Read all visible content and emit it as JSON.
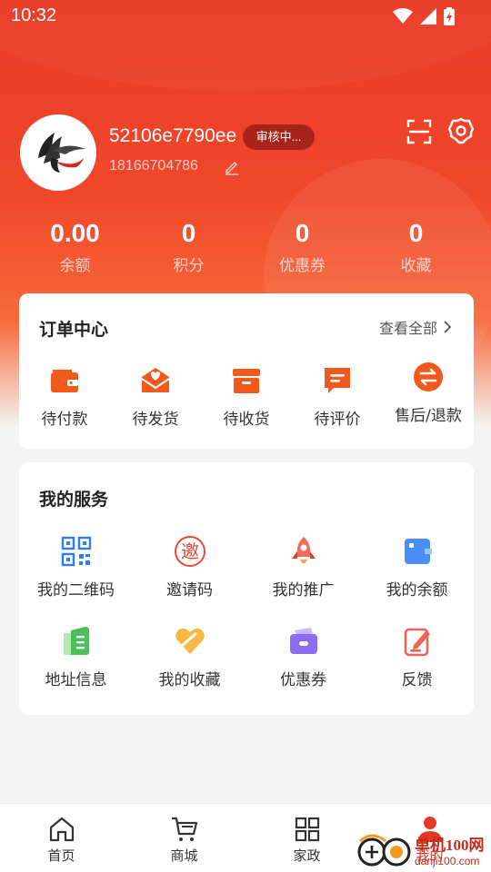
{
  "status_bar": {
    "time": "10:32",
    "icons": [
      "wifi-icon",
      "signal-icon",
      "battery-icon"
    ]
  },
  "profile": {
    "username": "52106e7790ee",
    "badge": "审核中...",
    "phone": "18166704786"
  },
  "stats": [
    {
      "value": "0.00",
      "label": "余额"
    },
    {
      "value": "0",
      "label": "积分"
    },
    {
      "value": "0",
      "label": "优惠券"
    },
    {
      "value": "0",
      "label": "收藏"
    }
  ],
  "orders": {
    "title": "订单中心",
    "view_all": "查看全部",
    "items": [
      {
        "label": "待付款",
        "icon": "wallet-icon"
      },
      {
        "label": "待发货",
        "icon": "package-heart-icon"
      },
      {
        "label": "待收货",
        "icon": "box-icon"
      },
      {
        "label": "待评价",
        "icon": "chat-icon"
      },
      {
        "label": "售后/退款",
        "icon": "exchange-icon"
      }
    ]
  },
  "services": {
    "title": "我的服务",
    "items": [
      {
        "label": "我的二维码",
        "icon": "qr-code-icon"
      },
      {
        "label": "邀请码",
        "icon": "invite-stamp-icon",
        "glyph": "邀"
      },
      {
        "label": "我的推广",
        "icon": "rocket-icon"
      },
      {
        "label": "我的余额",
        "icon": "balance-card-icon"
      },
      {
        "label": "地址信息",
        "icon": "address-book-icon"
      },
      {
        "label": "我的收藏",
        "icon": "heart-icon"
      },
      {
        "label": "优惠券",
        "icon": "coupon-icon"
      },
      {
        "label": "反馈",
        "icon": "feedback-icon"
      }
    ]
  },
  "tabbar": [
    {
      "label": "首页",
      "icon": "home-icon"
    },
    {
      "label": "商城",
      "icon": "cart-icon"
    },
    {
      "label": "家政",
      "icon": "grid-icon"
    },
    {
      "label": "我的",
      "icon": "user-icon"
    }
  ],
  "watermark": {
    "text": "单机100网",
    "url": "danji100.com"
  },
  "colors": {
    "primary": "#e53825",
    "orange": "#f25a1d",
    "badge_bg": "#a8231a"
  }
}
